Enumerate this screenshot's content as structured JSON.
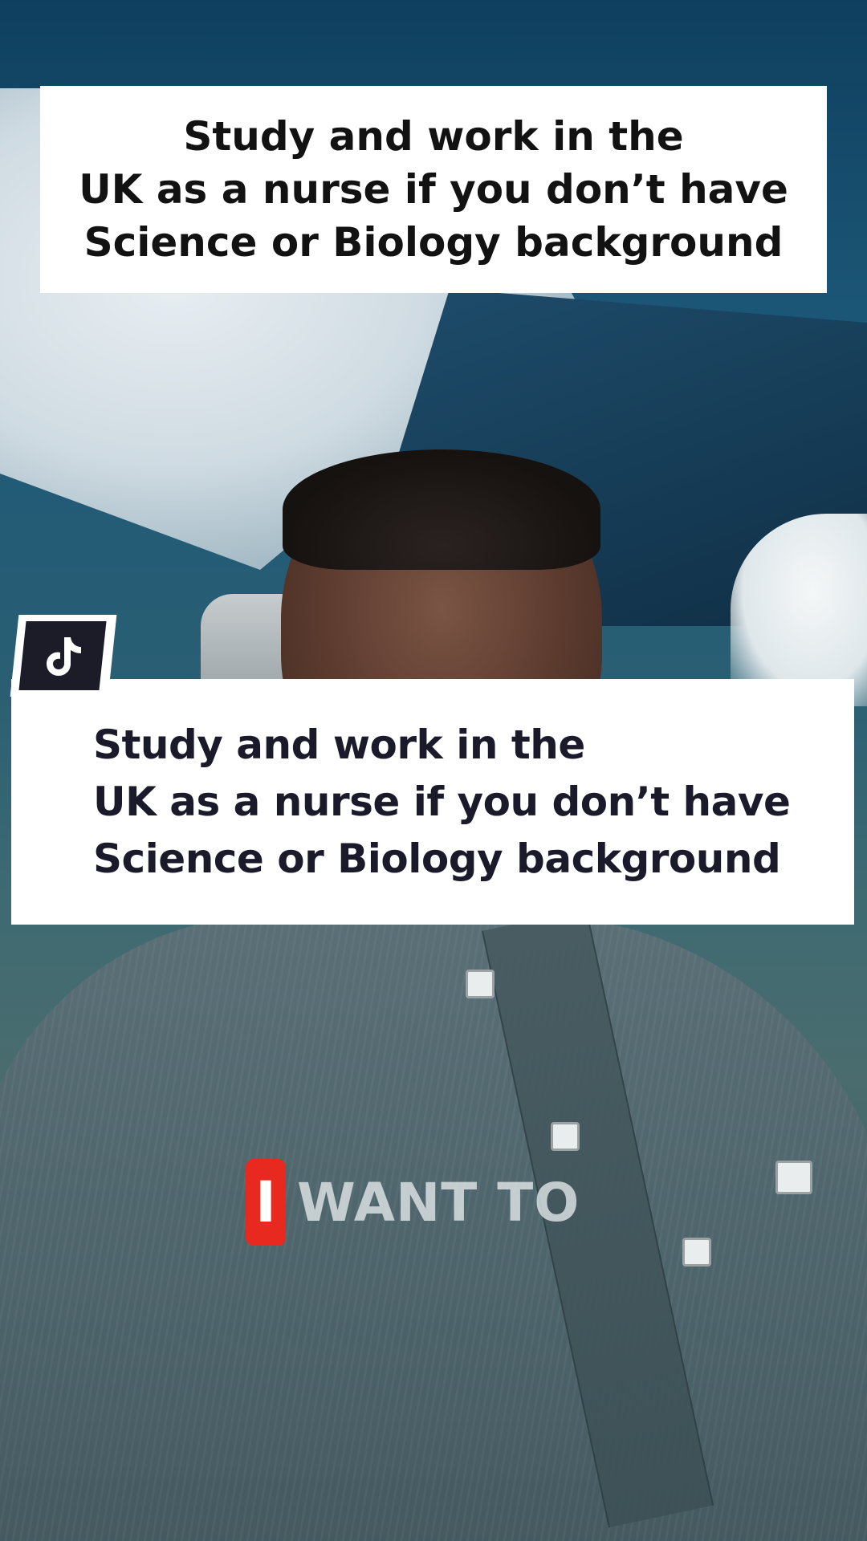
{
  "top_caption": {
    "lines": [
      "Study and work in the",
      "UK as a nurse if you don’t have",
      "Science or Biology background"
    ]
  },
  "main_caption": {
    "lines": [
      "Study and work in the",
      "UK as a nurse if you don’t have",
      "Science or Biology background"
    ]
  },
  "tiktok_badge": {
    "icon": "tiktok-logo-icon"
  },
  "subtitle": {
    "highlighted_word": "I",
    "rest": "WANT TO"
  },
  "colors": {
    "caption_background": "#ffffff",
    "caption_text": "#1b1a2b",
    "subtitle_highlight": "#e8291f",
    "badge_background": "#1c1c28"
  }
}
